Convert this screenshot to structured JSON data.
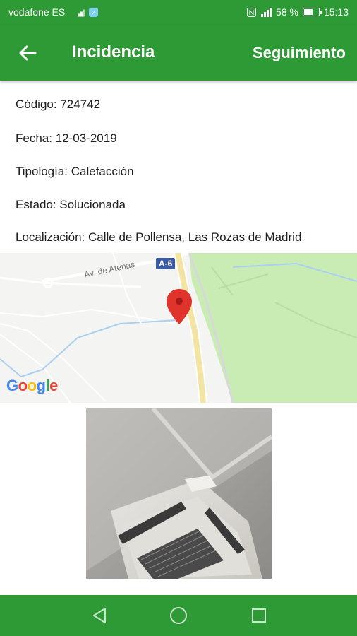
{
  "status_bar": {
    "carrier": "vodafone ES",
    "battery": "58 %",
    "battery_level": 0.58,
    "time": "15:13"
  },
  "app_bar": {
    "back_icon": "arrow-left-icon",
    "title": "Incidencia",
    "action": "Seguimiento"
  },
  "details": {
    "code": "Código: 724742",
    "date": "Fecha: 12-03-2019",
    "type": "Tipología: Calefacción",
    "status": "Estado: Solucionada",
    "location": "Localización: Calle de Pollensa, Las Rozas de Madrid"
  },
  "map": {
    "street_label": "Av. de Atenas",
    "road_shield": "A-6",
    "attribution": "Google",
    "pin_icon": "map-pin-icon",
    "colors": {
      "road": "#f3e4a3",
      "park": "#c9ecb5",
      "water": "#a9d0f0",
      "land": "#f4f4f2",
      "pin": "#e0332b"
    }
  },
  "photo": {
    "subject": "ceiling air conditioning unit"
  },
  "nav_bar": {
    "back_icon": "triangle-back-icon",
    "home_icon": "circle-home-icon",
    "recents_icon": "square-recents-icon"
  },
  "colors": {
    "primary": "#2e9a36"
  }
}
